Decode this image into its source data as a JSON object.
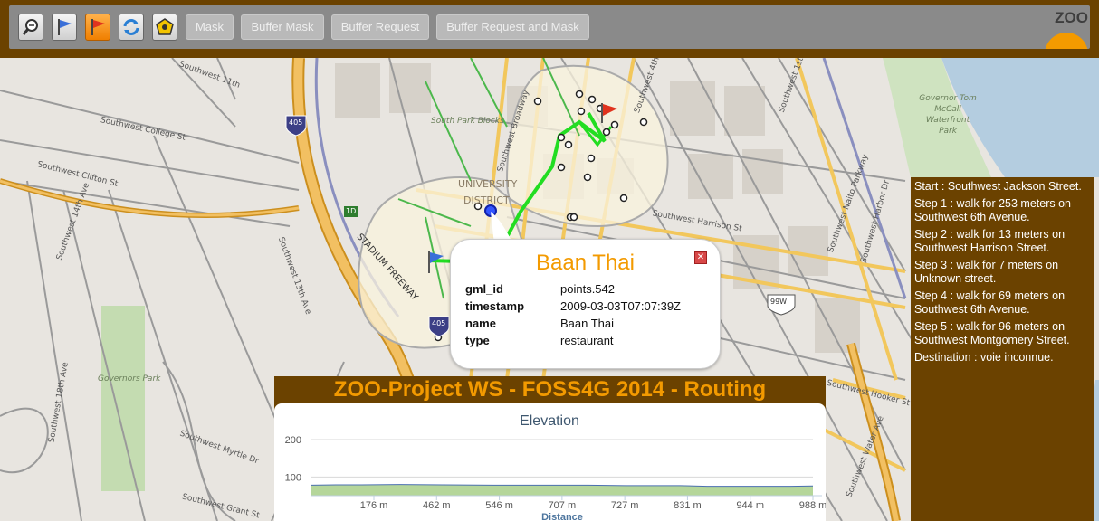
{
  "toolbar": {
    "tools": [
      {
        "name": "zoom-icon",
        "active": false
      },
      {
        "name": "start-flag-icon",
        "active": false
      },
      {
        "name": "end-flag-icon",
        "active": true
      },
      {
        "name": "refresh-icon",
        "active": false
      },
      {
        "name": "polygon-icon",
        "active": false
      }
    ],
    "buttons": {
      "mask": "Mask",
      "buffer_mask": "Buffer Mask",
      "buffer_request": "Buffer Request",
      "buffer_request_mask": "Buffer Request and Mask"
    },
    "logo_text": "ZOO",
    "colors": {
      "bar": "#6b4200",
      "active": "#f39a00"
    }
  },
  "map": {
    "labels": {
      "sw_11th": "Southwest 11th",
      "sw_college": "Southwest College St",
      "sw_clifton": "Southwest Clifton St",
      "sw_14th": "Southwest 14th Ave",
      "sw_13th": "Southwest 13th Ave",
      "sw_18th": "Southwest 18th Ave",
      "south_park": "South Park Blocks",
      "sw_broadway": "Southwest Broadway",
      "university": "UNIVERSITY",
      "district": "DISTRICT",
      "sw_4th": "Southwest 4th Ave",
      "sw_harrison": "Southwest Harrison St",
      "sw_1st": "Southwest 1st Ave",
      "sw_naito": "Southwest Naito Parkway",
      "sw_harbor": "Southwest Harbor Dr",
      "stadium_fwy": "STADIUM FREEWAY",
      "governors_park": "Governors Park",
      "sw_myrtle": "Southwest Myrtle Dr",
      "mccall": "Governor Tom McCall Waterfront Park",
      "sw_hooker": "Southwest Hooker St",
      "sw_water": "Southwest Water Ave",
      "sw_grant": "Southwest Grant St",
      "shield_405a": "405",
      "shield_405b": "405",
      "shield_99w": "99W",
      "exit_1d": "1D"
    }
  },
  "popup": {
    "title": "Baan Thai",
    "rows": [
      {
        "key": "gml_id",
        "value": "points.542"
      },
      {
        "key": "timestamp",
        "value": "2009-03-03T07:07:39Z"
      },
      {
        "key": "name",
        "value": "Baan Thai"
      },
      {
        "key": "type",
        "value": "restaurant"
      }
    ]
  },
  "directions": {
    "steps": [
      "Start : Southwest Jackson Street.",
      "Step 1 : walk for 253 meters on Southwest 6th Avenue.",
      "Step 2 : walk for 13 meters on Southwest Harrison Street.",
      "Step 3 : walk for 7 meters on Unknown street.",
      "Step 4 : walk for 69 meters on Southwest 6th Avenue.",
      "Step 5 : walk for 96 meters on Southwest Montgomery Street.",
      "Destination : voie inconnue."
    ]
  },
  "elevation_panel": {
    "title": "ZOO-Project WS - FOSS4G 2014 - Routing"
  },
  "chart_data": {
    "type": "area",
    "title": "Elevation",
    "xlabel": "Distance",
    "ylabel": "",
    "ylim": [
      50,
      200
    ],
    "yticks": [
      100,
      200
    ],
    "xticks": [
      "176 m",
      "462 m",
      "546 m",
      "707 m",
      "727 m",
      "831 m",
      "944 m",
      "988 m"
    ],
    "x": [
      0,
      50,
      100,
      176,
      260,
      360,
      462,
      546,
      620,
      707,
      727,
      780,
      831,
      900,
      944,
      988
    ],
    "y": [
      78,
      79,
      79,
      80,
      79,
      78,
      78,
      78,
      77,
      77,
      77,
      75,
      75,
      75,
      75,
      76
    ],
    "colors": {
      "fill": "#b5d69a",
      "line": "#4a6fb0"
    }
  }
}
